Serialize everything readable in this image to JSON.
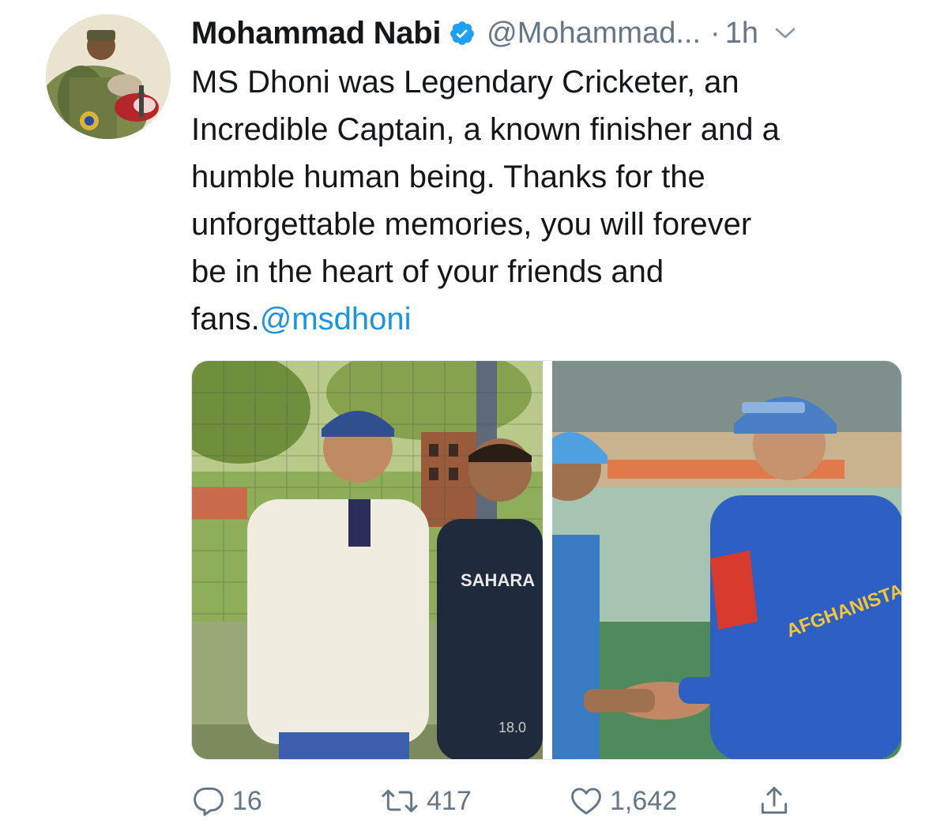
{
  "tweet": {
    "author": {
      "display_name": "Mohammad Nabi",
      "handle": "@Mohammad...",
      "verified": true,
      "avatar_icon": "profile-photo"
    },
    "separator": "·",
    "time": "1h",
    "text_lines": [
      "MS Dhoni was Legendary Cricketer, an",
      "Incredible Captain, a known finisher and a",
      "humble human being. Thanks for the",
      "unforgettable memories, you will forever",
      "be in the heart of your friends and"
    ],
    "last_line_prefix": "fans.",
    "mention": "@msdhoni",
    "media": {
      "left_photo": {
        "shirt_text": "SAHARA",
        "number_text": "18.0"
      },
      "right_photo": {
        "shirt_text": "AFGHANISTAN"
      }
    },
    "actions": {
      "reply": {
        "icon": "reply-icon",
        "count": "16"
      },
      "retweet": {
        "icon": "retweet-icon",
        "count": "417"
      },
      "like": {
        "icon": "heart-icon",
        "count": "1,642"
      },
      "share": {
        "icon": "share-icon"
      }
    }
  },
  "colors": {
    "text": "#14171a",
    "secondary": "#657786",
    "link": "#1b95e0",
    "verified": "#1da1f2"
  }
}
